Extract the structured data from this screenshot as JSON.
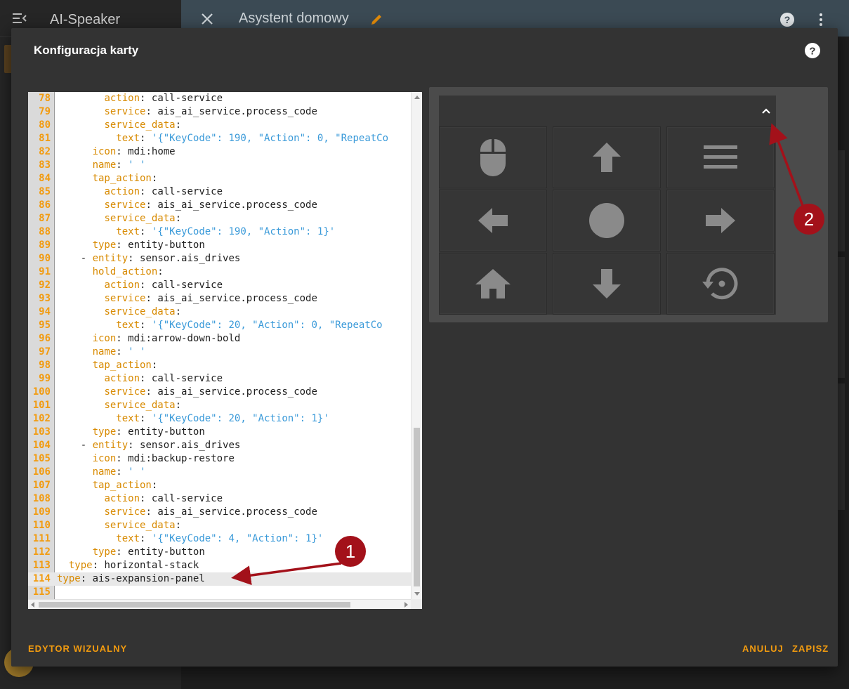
{
  "sidebar": {
    "title": "AI-Speaker",
    "menu_icon": "menu-open-icon"
  },
  "topbar": {
    "title": "Asystent domowy",
    "close_icon": "close-icon",
    "edit_icon": "pencil-icon",
    "help_icon": "help-icon",
    "more_icon": "dots-vertical-icon"
  },
  "dialog": {
    "title": "Konfiguracja karty",
    "help_icon": "help-circle-icon",
    "visual_editor_label": "EDYTOR WIZUALNY",
    "cancel_label": "ANULUJ",
    "save_label": "ZAPISZ"
  },
  "editor": {
    "active_line": 114,
    "lines": [
      {
        "n": "78",
        "indent": "        ",
        "key": "action",
        "val": "call-service",
        "str": ""
      },
      {
        "n": "79",
        "indent": "        ",
        "key": "service",
        "val": "ais_ai_service.process_code",
        "str": ""
      },
      {
        "n": "80",
        "indent": "        ",
        "key": "service_data",
        "val": "",
        "str": ""
      },
      {
        "n": "81",
        "indent": "          ",
        "key": "text",
        "val": "",
        "str": "'{\"KeyCode\": 190, \"Action\": 0, \"RepeatCo"
      },
      {
        "n": "82",
        "indent": "      ",
        "key": "icon",
        "val": "mdi:home",
        "str": ""
      },
      {
        "n": "83",
        "indent": "      ",
        "key": "name",
        "val": "",
        "str": "' '"
      },
      {
        "n": "84",
        "indent": "      ",
        "key": "tap_action",
        "val": "",
        "str": ""
      },
      {
        "n": "85",
        "indent": "        ",
        "key": "action",
        "val": "call-service",
        "str": ""
      },
      {
        "n": "86",
        "indent": "        ",
        "key": "service",
        "val": "ais_ai_service.process_code",
        "str": ""
      },
      {
        "n": "87",
        "indent": "        ",
        "key": "service_data",
        "val": "",
        "str": ""
      },
      {
        "n": "88",
        "indent": "          ",
        "key": "text",
        "val": "",
        "str": "'{\"KeyCode\": 190, \"Action\": 1}'"
      },
      {
        "n": "89",
        "indent": "      ",
        "key": "type",
        "val": "entity-button",
        "str": ""
      },
      {
        "n": "90",
        "indent": "    - ",
        "key": "entity",
        "val": "sensor.ais_drives",
        "str": ""
      },
      {
        "n": "91",
        "indent": "      ",
        "key": "hold_action",
        "val": "",
        "str": ""
      },
      {
        "n": "92",
        "indent": "        ",
        "key": "action",
        "val": "call-service",
        "str": ""
      },
      {
        "n": "93",
        "indent": "        ",
        "key": "service",
        "val": "ais_ai_service.process_code",
        "str": ""
      },
      {
        "n": "94",
        "indent": "        ",
        "key": "service_data",
        "val": "",
        "str": ""
      },
      {
        "n": "95",
        "indent": "          ",
        "key": "text",
        "val": "",
        "str": "'{\"KeyCode\": 20, \"Action\": 0, \"RepeatCo"
      },
      {
        "n": "96",
        "indent": "      ",
        "key": "icon",
        "val": "mdi:arrow-down-bold",
        "str": ""
      },
      {
        "n": "97",
        "indent": "      ",
        "key": "name",
        "val": "",
        "str": "' '"
      },
      {
        "n": "98",
        "indent": "      ",
        "key": "tap_action",
        "val": "",
        "str": ""
      },
      {
        "n": "99",
        "indent": "        ",
        "key": "action",
        "val": "call-service",
        "str": ""
      },
      {
        "n": "100",
        "indent": "        ",
        "key": "service",
        "val": "ais_ai_service.process_code",
        "str": ""
      },
      {
        "n": "101",
        "indent": "        ",
        "key": "service_data",
        "val": "",
        "str": ""
      },
      {
        "n": "102",
        "indent": "          ",
        "key": "text",
        "val": "",
        "str": "'{\"KeyCode\": 20, \"Action\": 1}'"
      },
      {
        "n": "103",
        "indent": "      ",
        "key": "type",
        "val": "entity-button",
        "str": ""
      },
      {
        "n": "104",
        "indent": "    - ",
        "key": "entity",
        "val": "sensor.ais_drives",
        "str": ""
      },
      {
        "n": "105",
        "indent": "      ",
        "key": "icon",
        "val": "mdi:backup-restore",
        "str": ""
      },
      {
        "n": "106",
        "indent": "      ",
        "key": "name",
        "val": "",
        "str": "' '"
      },
      {
        "n": "107",
        "indent": "      ",
        "key": "tap_action",
        "val": "",
        "str": ""
      },
      {
        "n": "108",
        "indent": "        ",
        "key": "action",
        "val": "call-service",
        "str": ""
      },
      {
        "n": "109",
        "indent": "        ",
        "key": "service",
        "val": "ais_ai_service.process_code",
        "str": ""
      },
      {
        "n": "110",
        "indent": "        ",
        "key": "service_data",
        "val": "",
        "str": ""
      },
      {
        "n": "111",
        "indent": "          ",
        "key": "text",
        "val": "",
        "str": "'{\"KeyCode\": 4, \"Action\": 1}'"
      },
      {
        "n": "112",
        "indent": "      ",
        "key": "type",
        "val": "entity-button",
        "str": ""
      },
      {
        "n": "113",
        "indent": "  ",
        "key": "type",
        "val": "horizontal-stack",
        "str": ""
      },
      {
        "n": "114",
        "indent": "",
        "key": "type",
        "val": "ais-expansion-panel",
        "str": ""
      },
      {
        "n": "115",
        "indent": "",
        "key": "",
        "val": "",
        "str": ""
      }
    ]
  },
  "preview": {
    "collapse_icon": "chevron-up-icon",
    "buttons": [
      {
        "icon": "mouse-icon"
      },
      {
        "icon": "arrow-up-bold-icon"
      },
      {
        "icon": "menu-icon"
      },
      {
        "icon": "arrow-left-bold-icon"
      },
      {
        "icon": "circle-icon"
      },
      {
        "icon": "arrow-right-bold-icon"
      },
      {
        "icon": "home-icon"
      },
      {
        "icon": "arrow-down-bold-icon"
      },
      {
        "icon": "backup-restore-icon"
      }
    ]
  },
  "annotations": [
    {
      "label": "1"
    },
    {
      "label": "2"
    }
  ],
  "colors": {
    "accent": "#f29b0f",
    "annotation": "#a3111a"
  }
}
